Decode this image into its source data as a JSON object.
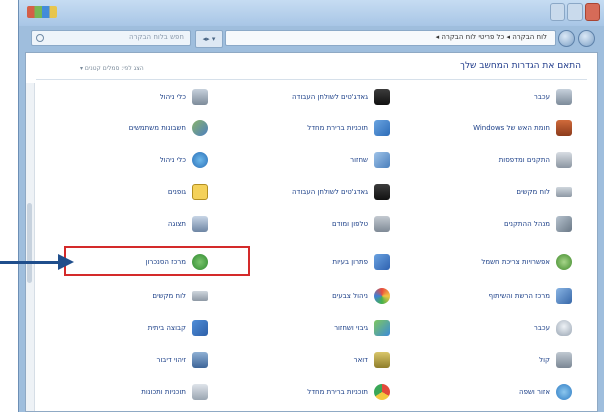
{
  "window": {
    "title": "",
    "address": "לוח הבקרה ◂ כל פריטי לוח הבקרה ◂",
    "search_placeholder": "חפש בלוח הבקרה",
    "refresh_label": "◂▸ ▾"
  },
  "content": {
    "heading": "התאם את הגדרות המחשב שלך",
    "view_by": "הצג לפי: סמלים קטנים ▾"
  },
  "items": [
    {
      "name": "top-left",
      "label": "חשבונות משתמשים",
      "icon": "users-icon"
    },
    {
      "name": "fonts",
      "label": "גופנים",
      "icon": "fonts-icon"
    },
    {
      "name": "ease",
      "label": "מרכז נוחות הגישה",
      "icon": "ease-icon"
    },
    {
      "name": "gadgets",
      "label": "גאדג'טים לשולחן העבודה",
      "icon": "gadgets-icon"
    },
    {
      "name": "mouse",
      "label": "עכבר",
      "icon": "mouse-icon"
    },
    {
      "name": "printers",
      "label": "התקנים ומדפסות",
      "icon": "printers-icon"
    },
    {
      "name": "devmgr",
      "label": "מנהל ההתקנים",
      "icon": "devmgr-icon"
    },
    {
      "name": "power",
      "label": "אפשרויות צריכת חשמל",
      "icon": "power-icon"
    },
    {
      "name": "sync",
      "label": "מרכז הסנכרון",
      "icon": "sync-icon"
    },
    {
      "name": "color",
      "label": "ניהול צבעים",
      "icon": "color-icon"
    },
    {
      "name": "mail",
      "label": "דואר",
      "icon": "mail-icon"
    },
    {
      "name": "firewall",
      "label": "חומת האש של Windows",
      "icon": "firewall-icon"
    },
    {
      "name": "keyboard",
      "label": "לוח מקשים",
      "icon": "keyboard-icon"
    },
    {
      "name": "homegroup",
      "label": "קבוצה ביתית",
      "icon": "homegroup-icon"
    },
    {
      "name": "default",
      "label": "תוכניות ברירת מחדל",
      "icon": "default-programs-icon"
    },
    {
      "name": "sound",
      "label": "קול",
      "icon": "sound-icon"
    },
    {
      "name": "region",
      "label": "אזור ושפה",
      "icon": "region-icon"
    },
    {
      "name": "backup",
      "label": "גיבוי ושחזור",
      "icon": "backup-icon"
    },
    {
      "name": "network",
      "label": "מרכז הרשת והשיתוף",
      "icon": "network-icon"
    },
    {
      "name": "display",
      "label": "תצוגה",
      "icon": "display-icon"
    },
    {
      "name": "recovery",
      "label": "שחזור",
      "icon": "recovery-icon"
    },
    {
      "name": "phone",
      "label": "טלפון ומודם",
      "icon": "phone-icon"
    },
    {
      "name": "speech",
      "label": "זיהוי דיבור",
      "icon": "speech-icon"
    },
    {
      "name": "troubleshoot",
      "label": "פתרון בעיות",
      "icon": "troubleshoot-icon"
    },
    {
      "name": "chrome",
      "label": "תוכניות ברירת מחדל",
      "icon": "chrome-icon"
    },
    {
      "name": "progs",
      "label": "תוכניות ותכונות",
      "icon": "programs-icon"
    },
    {
      "name": "generic",
      "label": "כלי ניהול",
      "icon": "admin-tools-icon"
    }
  ]
}
